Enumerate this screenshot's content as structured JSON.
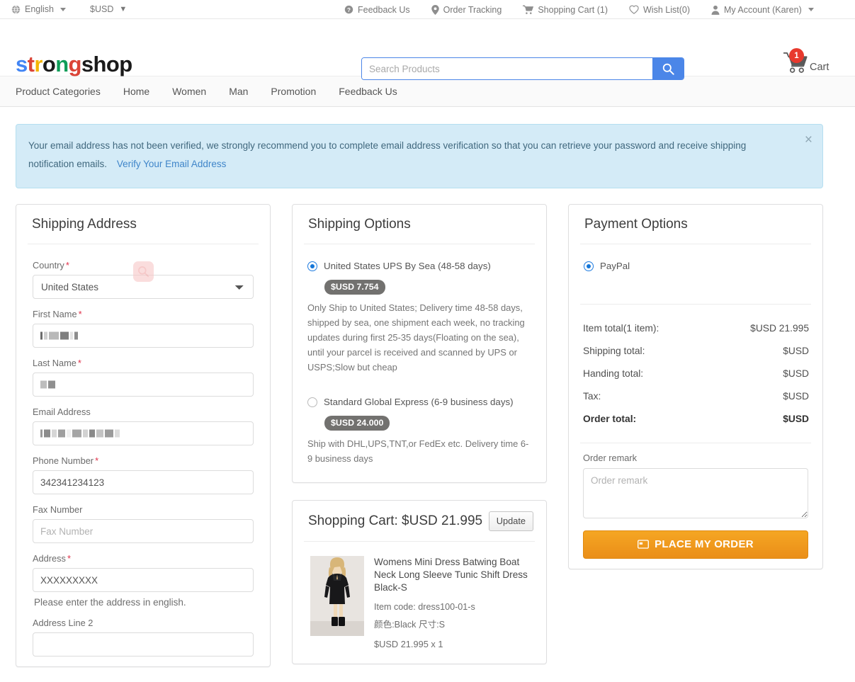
{
  "topbar": {
    "language": "English",
    "currency": "$USD",
    "links": [
      {
        "label": "Feedback Us",
        "icon": "question-circle-icon"
      },
      {
        "label": "Order Tracking",
        "icon": "map-pin-icon"
      },
      {
        "label": "Shopping Cart (1)",
        "icon": "cart-icon"
      },
      {
        "label": "Wish List(0)",
        "icon": "heart-icon"
      },
      {
        "label": "My Account (Karen)",
        "icon": "user-icon"
      }
    ]
  },
  "header": {
    "logo_parts": [
      {
        "char": "s",
        "color": "#4285f4"
      },
      {
        "char": "t",
        "color": "#db4437"
      },
      {
        "char": "r",
        "color": "#f4b400"
      },
      {
        "char": "o",
        "color": "#1a1a1a"
      },
      {
        "char": "n",
        "color": "#0f9d58"
      },
      {
        "char": "g",
        "color": "#db4437"
      },
      {
        "char": "shop",
        "color": "#1a1a1a"
      }
    ],
    "logo_text": "strongshop",
    "search_placeholder": "Search Products",
    "search_value": "",
    "search_icon": "search-icon",
    "cart_label": "Cart",
    "cart_count": "1",
    "accent_blue": "#4b86e8",
    "badge_red": "#e8392d"
  },
  "nav": {
    "items": [
      "Product Categories",
      "Home",
      "Women",
      "Man",
      "Promotion",
      "Feedback Us"
    ]
  },
  "alert": {
    "message": "Your email address has not been verified, we strongly recommend you to complete email address verification so that you can retrieve your password and receive shipping notification emails.",
    "link": "Verify Your Email Address",
    "close": "×"
  },
  "shipping_address": {
    "title": "Shipping Address",
    "fields": [
      {
        "label": "Country",
        "required": true,
        "type": "select",
        "value": "United States"
      },
      {
        "label": "First Name",
        "required": true,
        "type": "text",
        "value": "",
        "redacted": true
      },
      {
        "label": "Last Name",
        "required": true,
        "type": "text",
        "value": "",
        "redacted": true
      },
      {
        "label": "Email Address",
        "required": false,
        "type": "text",
        "value": "",
        "redacted": true
      },
      {
        "label": "Phone Number",
        "required": true,
        "type": "text",
        "value": "342341234123"
      },
      {
        "label": "Fax Number",
        "required": false,
        "type": "text",
        "value": "",
        "placeholder": "Fax Number"
      },
      {
        "label": "Address",
        "required": true,
        "type": "text",
        "value": "XXXXXXXXX",
        "hint": "Please enter the address in english."
      },
      {
        "label": "Address Line 2",
        "required": false,
        "type": "text",
        "value": ""
      }
    ],
    "country_value": "United States",
    "first_name_label": "First Name",
    "last_name_label": "Last Name",
    "email_label": "Email Address",
    "phone_label": "Phone Number",
    "phone_value": "342341234123",
    "fax_label": "Fax Number",
    "fax_placeholder": "Fax Number",
    "address_label": "Address",
    "address_value": "XXXXXXXXX",
    "address_hint": "Please enter the address in english.",
    "address2_label": "Address Line 2",
    "country_label": "Country"
  },
  "shipping_options": {
    "title": "Shipping Options",
    "options": [
      {
        "label": "United States UPS By Sea (48-58 days)",
        "price": "$USD 7.754",
        "selected": true,
        "description": "Only Ship to United States; Delivery time 48-58 days, shipped by sea, one shipment each week,  no tracking updates during first 25-35 days(Floating on the sea), until your parcel is received and scanned by UPS or USPS;Slow but cheap"
      },
      {
        "label": "Standard Global Express (6-9 business days)",
        "price": "$USD 24.000",
        "selected": false,
        "description": "Ship with DHL,UPS,TNT,or FedEx etc. Delivery time 6-9 business days"
      }
    ]
  },
  "cart": {
    "title": "Shopping Cart: $USD 21.995",
    "update_label": "Update",
    "item": {
      "name": "Womens Mini Dress Batwing Boat Neck Long Sleeve Tunic Shift Dress Black-S",
      "item_code": "Item code: dress100-01-s",
      "variant": "颜色:Black 尺寸:S",
      "line_price": "$USD 21.995 x 1"
    }
  },
  "payment": {
    "title": "Payment Options",
    "method": "PayPal",
    "method_selected": true,
    "totals": [
      {
        "label": "Item total(1 item):",
        "value": "$USD 21.995",
        "bold": false
      },
      {
        "label": "Shipping total:",
        "value": "$USD",
        "bold": false
      },
      {
        "label": "Handing total:",
        "value": "$USD",
        "bold": false
      },
      {
        "label": "Tax:",
        "value": "$USD",
        "bold": false
      },
      {
        "label": "Order total:",
        "value": "$USD",
        "bold": true
      }
    ],
    "remark_label": "Order remark",
    "remark_placeholder": "Order remark",
    "remark_value": "",
    "place_order_label": "PLACE MY ORDER",
    "place_order_icon": "credit-card-icon",
    "order_button_color": "#f0981b"
  }
}
